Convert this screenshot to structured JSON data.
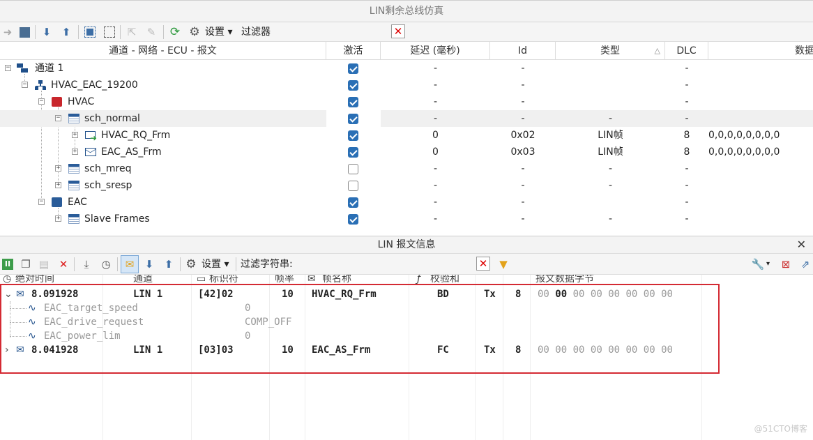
{
  "window": {
    "title": "LIN剩余总线仿真"
  },
  "toolbar1": {
    "settings_label": "设置",
    "filter_label": "过滤器",
    "filter_value": ""
  },
  "tree_columns": [
    "通道 - 网络 - ECU - 报文",
    "激活",
    "延迟 (毫秒)",
    "Id",
    "类型",
    "DLC",
    "数据"
  ],
  "tree_rows": [
    {
      "name": "通道 1",
      "active": true,
      "delay": "-",
      "id": "-",
      "type": "",
      "dlc": "-",
      "data": ""
    },
    {
      "name": "HVAC_EAC_19200",
      "active": true,
      "delay": "-",
      "id": "-",
      "type": "",
      "dlc": "-",
      "data": ""
    },
    {
      "name": "HVAC",
      "active": true,
      "delay": "-",
      "id": "-",
      "type": "",
      "dlc": "-",
      "data": ""
    },
    {
      "name": "sch_normal",
      "active": true,
      "delay": "-",
      "id": "-",
      "type": "-",
      "dlc": "-",
      "data": ""
    },
    {
      "name": "HVAC_RQ_Frm",
      "active": true,
      "delay": "0",
      "id": "0x02",
      "type": "LIN帧",
      "dlc": "8",
      "data": "0,0,0,0,0,0,0,0"
    },
    {
      "name": "EAC_AS_Frm",
      "active": true,
      "delay": "0",
      "id": "0x03",
      "type": "LIN帧",
      "dlc": "8",
      "data": "0,0,0,0,0,0,0,0"
    },
    {
      "name": "sch_mreq",
      "active": false,
      "delay": "-",
      "id": "-",
      "type": "-",
      "dlc": "-",
      "data": ""
    },
    {
      "name": "sch_sresp",
      "active": false,
      "delay": "-",
      "id": "-",
      "type": "-",
      "dlc": "-",
      "data": ""
    },
    {
      "name": "EAC",
      "active": true,
      "delay": "-",
      "id": "-",
      "type": "",
      "dlc": "-",
      "data": ""
    },
    {
      "name": "Slave Frames",
      "active": true,
      "delay": "-",
      "id": "-",
      "type": "-",
      "dlc": "-",
      "data": ""
    }
  ],
  "msg_panel": {
    "title": "LIN 报文信息",
    "settings_label": "设置",
    "filter_label": "过滤字符串:",
    "filter_value": ""
  },
  "msg_columns": [
    "绝对时间",
    "通道",
    "标识符",
    "帧率",
    "帧名称",
    "校验和",
    "报文数据字节"
  ],
  "messages": [
    {
      "time": "8.091928",
      "channel": "LIN 1",
      "identifier": "[42]02",
      "rate": "10",
      "name": "HVAC_RQ_Frm",
      "checksum": "BD",
      "dir": "Tx",
      "dlc": "8",
      "bytes": [
        "00",
        "00",
        "00",
        "00",
        "00",
        "00",
        "00",
        "00"
      ],
      "expanded": true,
      "signals": [
        {
          "name": "EAC_target_speed",
          "value": "0"
        },
        {
          "name": "EAC_drive_request",
          "value": "COMP_OFF"
        },
        {
          "name": "EAC_power_lim",
          "value": "0"
        }
      ]
    },
    {
      "time": "8.041928",
      "channel": "LIN 1",
      "identifier": "[03]03",
      "rate": "10",
      "name": "EAC_AS_Frm",
      "checksum": "FC",
      "dir": "Tx",
      "dlc": "8",
      "bytes": [
        "00",
        "00",
        "00",
        "00",
        "00",
        "00",
        "00",
        "00"
      ],
      "expanded": false,
      "signals": []
    }
  ],
  "watermark": "@51CTO博客",
  "colors": {
    "accent": "#2a6fb5",
    "highlight_box": "#d42a33",
    "close_red": "#dd0000"
  }
}
